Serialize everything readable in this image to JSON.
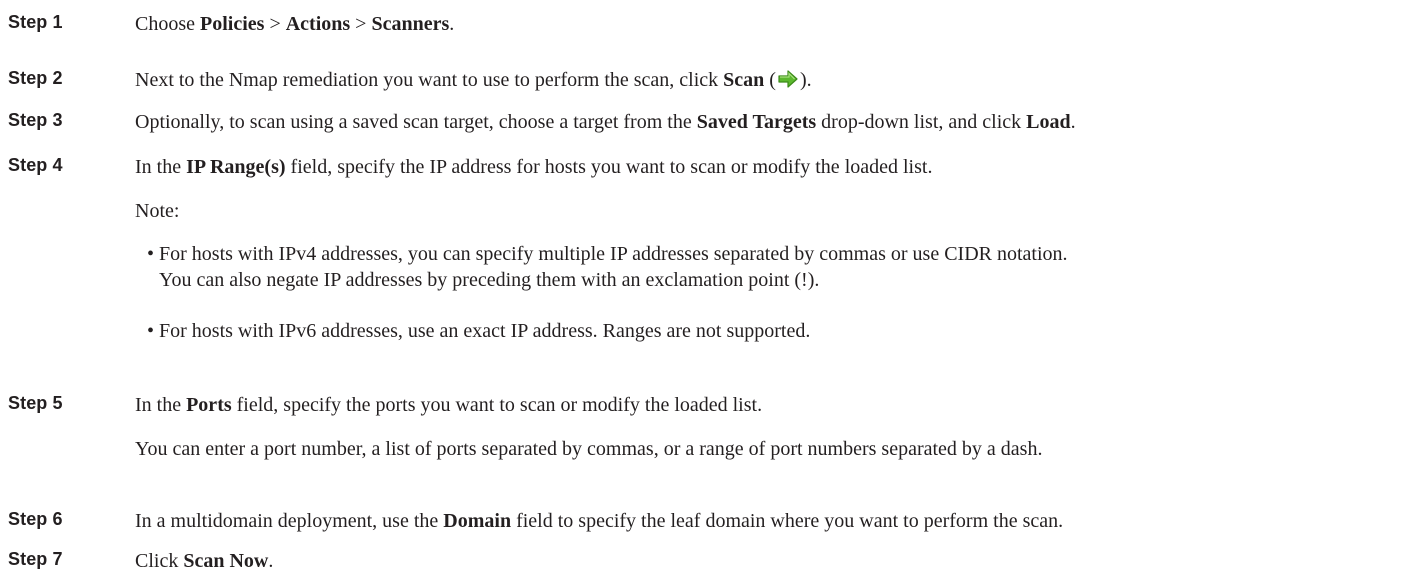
{
  "steps": [
    {
      "label": "Step 1",
      "parts": [
        "Choose ",
        "Policies",
        " > ",
        "Actions",
        " > ",
        "Scanners",
        "."
      ]
    },
    {
      "label": "Step 2",
      "parts": [
        "Next to the Nmap remediation you want to use to perform the scan, click ",
        "Scan",
        " (",
        ")."
      ]
    },
    {
      "label": "Step 3",
      "parts": [
        "Optionally, to scan using a saved scan target, choose a target from the ",
        "Saved Targets",
        " drop-down list, and click ",
        "Load",
        "."
      ]
    },
    {
      "label": "Step 4",
      "parts": [
        "In the ",
        "IP Range(s)",
        " field, specify the IP address for hosts you want to scan or modify the loaded list."
      ],
      "note_label": "Note:",
      "bullets": [
        {
          "line1": "For hosts with IPv4 addresses, you can specify multiple IP addresses separated by commas or use CIDR notation.",
          "line2": "You can also negate IP addresses by preceding them with an exclamation point (!)."
        },
        {
          "line1": "For hosts with IPv6 addresses, use an exact IP address. Ranges are not supported."
        }
      ]
    },
    {
      "label": "Step 5",
      "parts": [
        "In the ",
        "Ports",
        " field, specify the ports you want to scan or modify the loaded list."
      ],
      "detail": "You can enter a port number, a list of ports separated by commas, or a range of port numbers separated by a dash."
    },
    {
      "label": "Step 6",
      "parts": [
        "In a multidomain deployment, use the ",
        "Domain",
        " field to specify the leaf domain where you want to perform the scan."
      ]
    },
    {
      "label": "Step 7",
      "parts": [
        "Click ",
        "Scan Now",
        "."
      ]
    }
  ],
  "icons": {
    "scan_icon": "green-right-arrow-icon"
  },
  "colors": {
    "text": "#231f20",
    "icon_green": "#5cb82e"
  }
}
